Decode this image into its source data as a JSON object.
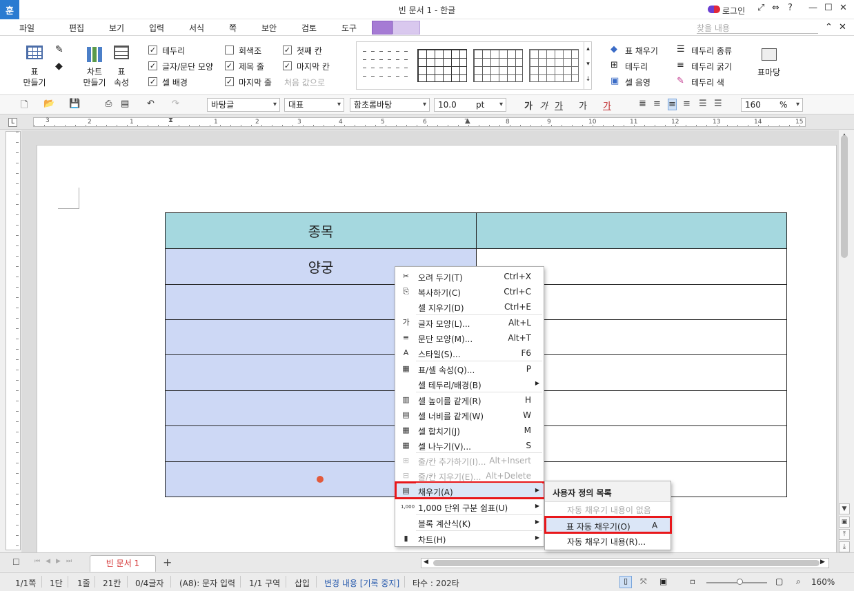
{
  "titlebar": {
    "app_logo": "훈",
    "title": "빈 문서 1 - 한글",
    "login": "로그인",
    "help": "?"
  },
  "menubar": {
    "file": "파일",
    "items": [
      "편집",
      "보기",
      "입력",
      "서식",
      "쪽",
      "보안",
      "검토",
      "도구"
    ],
    "search_placeholder": "찾을 내용"
  },
  "ribbon": {
    "table_make": "표\n만들기",
    "chart_make": "차트\n만들기",
    "table_props": "표\n속성",
    "checks": [
      {
        "label": "테두리",
        "checked": true
      },
      {
        "label": "글자/문단 모양",
        "checked": true
      },
      {
        "label": "셀 배경",
        "checked": true
      },
      {
        "label": "회색조",
        "checked": false
      },
      {
        "label": "제목 줄",
        "checked": true
      },
      {
        "label": "마지막 줄",
        "checked": true
      },
      {
        "label": "첫째 칸",
        "checked": true
      },
      {
        "label": "마지막 칸",
        "checked": true
      }
    ],
    "reset_label": "처음 값으로",
    "table_fill": "표 채우기",
    "border": "테두리",
    "cell_shade": "셀 음영",
    "border_type": "테두리 종류",
    "border_width": "테두리 굵기",
    "border_color": "테두리 색",
    "table_style": "표마당"
  },
  "format_bar": {
    "style": "바탕글",
    "lang": "대표",
    "font": "함초롬바탕",
    "size": "10.0",
    "unit": "pt",
    "zoom": "160",
    "zoom_unit": "%"
  },
  "ruler": {
    "h_numbers": [
      "3",
      "2",
      "1",
      "1",
      "2",
      "3",
      "4",
      "5",
      "6",
      "7",
      "8",
      "9",
      "10",
      "11",
      "12",
      "13",
      "14",
      "15"
    ]
  },
  "document": {
    "table_header": [
      "종목",
      ""
    ],
    "first_row": [
      "양궁",
      ""
    ],
    "empty_rows": 6
  },
  "context_menu": {
    "items": [
      {
        "icon": "cut-icon",
        "glyph": "✂",
        "label": "오려 두기(T)",
        "shortcut": "Ctrl+X",
        "disabled": false
      },
      {
        "icon": "copy-icon",
        "glyph": "⎘",
        "label": "복사하기(C)",
        "shortcut": "Ctrl+C",
        "disabled": false
      },
      {
        "icon": "",
        "glyph": "",
        "label": "셀 지우기(D)",
        "shortcut": "Ctrl+E",
        "disabled": false
      },
      {
        "icon": "char-shape-icon",
        "glyph": "가",
        "label": "글자 모양(L)...",
        "shortcut": "Alt+L",
        "disabled": false,
        "sep": true
      },
      {
        "icon": "para-shape-icon",
        "glyph": "≡",
        "label": "문단 모양(M)...",
        "shortcut": "Alt+T",
        "disabled": false
      },
      {
        "icon": "style-icon",
        "glyph": "A",
        "label": "스타일(S)...",
        "shortcut": "F6",
        "disabled": false
      },
      {
        "icon": "table-props-icon",
        "glyph": "▦",
        "label": "표/셀 속성(Q)...",
        "shortcut": "P",
        "disabled": false,
        "sep": true
      },
      {
        "icon": "",
        "glyph": "",
        "label": "셀 테두리/배경(B)",
        "shortcut": "",
        "disabled": false,
        "arrow": true
      },
      {
        "icon": "row-height-icon",
        "glyph": "▥",
        "label": "셀 높이를 같게(R)",
        "shortcut": "H",
        "disabled": false,
        "sep": true
      },
      {
        "icon": "col-width-icon",
        "glyph": "▤",
        "label": "셀 너비를 같게(W)",
        "shortcut": "W",
        "disabled": false
      },
      {
        "icon": "merge-icon",
        "glyph": "▦",
        "label": "셀 합치기(J)",
        "shortcut": "M",
        "disabled": false
      },
      {
        "icon": "split-icon",
        "glyph": "▦",
        "label": "셀 나누기(V)...",
        "shortcut": "S",
        "disabled": false
      },
      {
        "icon": "insert-rowcol-icon",
        "glyph": "⊞",
        "label": "줄/칸 추가하기(I)...",
        "shortcut": "Alt+Insert",
        "disabled": true,
        "sep": true
      },
      {
        "icon": "delete-rowcol-icon",
        "glyph": "⊟",
        "label": "줄/칸 지우기(E)...",
        "shortcut": "Alt+Delete",
        "disabled": true
      },
      {
        "icon": "fill-icon",
        "glyph": "▤",
        "label": "채우기(A)",
        "shortcut": "",
        "disabled": false,
        "arrow": true,
        "highlight": true,
        "sep": true
      },
      {
        "icon": "thousand-sep-icon",
        "glyph": "1,000",
        "label": "1,000 단위 구분 쉼표(U)",
        "shortcut": "",
        "disabled": false,
        "arrow": true
      },
      {
        "icon": "",
        "glyph": "",
        "label": "블록 계산식(K)",
        "shortcut": "",
        "disabled": false,
        "arrow": true,
        "sep": true
      },
      {
        "icon": "chart-icon",
        "glyph": "▮",
        "label": "차트(H)",
        "shortcut": "",
        "disabled": false,
        "arrow": true,
        "sep": true
      }
    ]
  },
  "sub_menu": {
    "header": "사용자 정의 목록",
    "empty": "자동 채우기 내용이 없음",
    "auto_fill": "표 자동 채우기(O)",
    "auto_fill_key": "A",
    "auto_fill_content": "자동 채우기 내용(R)..."
  },
  "tabs": {
    "doc": "빈 문서 1",
    "add": "+"
  },
  "status": {
    "page": "1/1쪽",
    "col": "1단",
    "line": "1줄",
    "pos": "21칸",
    "chars": "0/4글자",
    "cell": "(A8): 문자 입력",
    "section": "1/1 구역",
    "mode": "삽입",
    "track": "변경 내용 [기록 중지]",
    "typing": "타수 : 202타",
    "zoom": "160%"
  },
  "colors": {
    "header_fill": "#a5d8df",
    "selected_fill": "#cdd8f5",
    "highlight_border": "#e8171b",
    "accent": "#a57bd4"
  }
}
